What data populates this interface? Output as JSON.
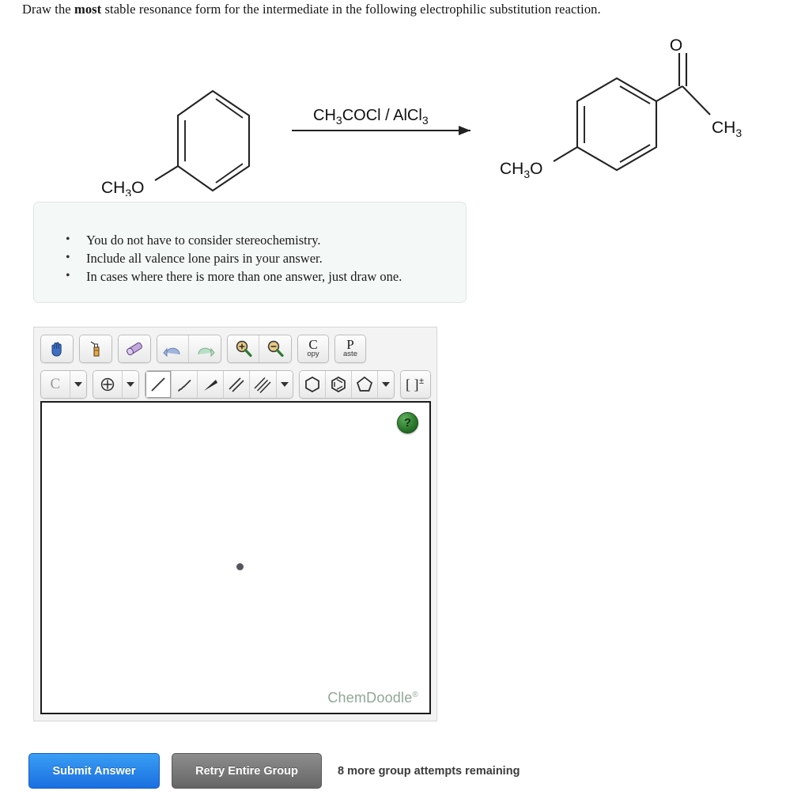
{
  "prompt": {
    "before": "Draw the ",
    "emphasis": "most",
    "after": " stable resonance form for the intermediate in the following electrophilic substitution reaction."
  },
  "reaction": {
    "reactant": {
      "name": "anisole",
      "substituent_label": "CH",
      "substituent_sub": "3",
      "substituent_tail": "O"
    },
    "reagent": {
      "part1": "CH",
      "part1_sub": "3",
      "part2": "COCl / AlCl",
      "part2_sub": "3",
      "full_text": "CH3COCl / AlCl3"
    },
    "product": {
      "name": "4'-methoxyacetophenone",
      "methoxy_label": "CH",
      "methoxy_sub": "3",
      "methoxy_tail": "O",
      "carbonyl_label": "O",
      "methyl_label": "CH",
      "methyl_sub": "3"
    }
  },
  "instructions": {
    "bullets": [
      "You do not have to consider stereochemistry.",
      "Include all valence lone pairs in your answer.",
      "In cases where there is more than one answer, just draw one."
    ]
  },
  "sketcher": {
    "toolbar_row1": [
      {
        "name": "pan-hand-tool",
        "icon": "hand-icon"
      },
      {
        "name": "clear-tool",
        "icon": "spray-bottle-icon"
      },
      {
        "name": "eraser-tool",
        "icon": "eraser-icon"
      },
      {
        "name": "undo-tool",
        "icon": "undo-arrow-icon"
      },
      {
        "name": "redo-tool",
        "icon": "redo-arrow-icon"
      },
      {
        "name": "zoom-in-tool",
        "icon": "magnifier-plus-icon"
      },
      {
        "name": "zoom-out-tool",
        "icon": "magnifier-minus-icon"
      }
    ],
    "copy_button": {
      "letter": "C",
      "rest": "opy"
    },
    "paste_button": {
      "letter": "P",
      "rest": "aste"
    },
    "element_button": {
      "label": "C"
    },
    "bond_tools": [
      {
        "name": "single-bond-tool",
        "selected": true
      },
      {
        "name": "hashed-wedge-bond-tool",
        "selected": false
      },
      {
        "name": "solid-wedge-bond-tool",
        "selected": false
      },
      {
        "name": "double-bond-tool",
        "selected": false
      },
      {
        "name": "triple-bond-tool",
        "selected": false
      }
    ],
    "ring_tools": [
      {
        "name": "cyclohexane-ring-tool"
      },
      {
        "name": "benzene-ring-tool"
      },
      {
        "name": "cyclopentane-ring-tool"
      }
    ],
    "bracket_tool": {
      "label": "[ ]±"
    },
    "canvas": {
      "help_label": "?",
      "watermark": "ChemDoodle",
      "watermark_mark": "®"
    }
  },
  "footer": {
    "submit_label": "Submit Answer",
    "retry_label": "Retry Entire Group",
    "attempts_text": "8 more group attempts remaining"
  },
  "colors": {
    "submit_blue": "#1a6fe0",
    "retry_gray": "#666666",
    "help_green": "#2d7a2d",
    "watermark_green": "#8fa894",
    "instruction_bg": "#f4f9f7"
  }
}
